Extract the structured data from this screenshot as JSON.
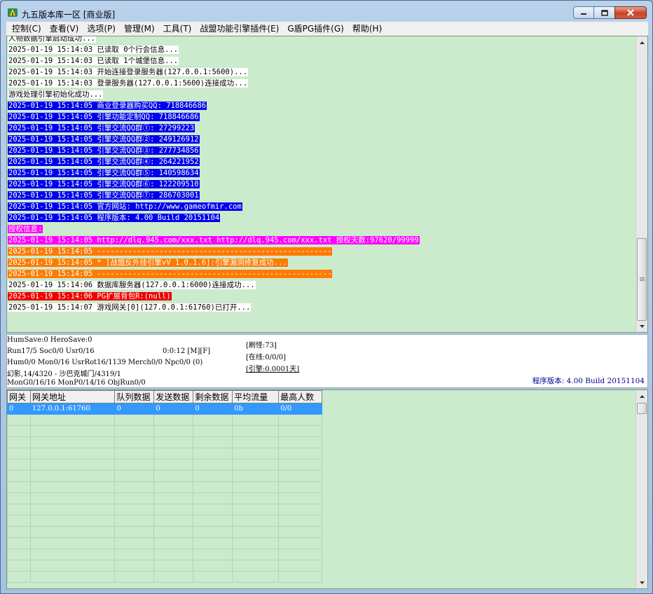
{
  "window": {
    "title": "九五版本库一区 [商业版]"
  },
  "menu": [
    "控制(C)",
    "查看(V)",
    "选项(P)",
    "管理(M)",
    "工具(T)",
    "战盟功能引擎插件(E)",
    "G盾PG插件(G)",
    "帮助(H)"
  ],
  "log": [
    {
      "text": "人物数据引擎启动成功...",
      "style": "white"
    },
    {
      "text": "2025-01-19 15:14:03 已读取 0个行会信息...",
      "style": "white"
    },
    {
      "text": "2025-01-19 15:14:03 已读取 1个城堡信息...",
      "style": "white"
    },
    {
      "text": "2025-01-19 15:14:03 开始连接登录服务器(127.0.0.1:5600)...",
      "style": "white"
    },
    {
      "text": "2025-01-19 15:14:03 登录服务器(127.0.0.1:5600)连接成功...",
      "style": "white"
    },
    {
      "text": "游戏处理引擎初始化成功...",
      "style": "white"
    },
    {
      "text": "2025-01-19 15:14:05 商业登录器购买QQ: 718846686",
      "style": "blue"
    },
    {
      "text": "2025-01-19 15:14:05 引擎功能定制QQ: 718846686",
      "style": "blue"
    },
    {
      "text": "2025-01-19 15:14:05 引擎交流QQ群①: 27299223",
      "style": "blue"
    },
    {
      "text": "2025-01-19 15:14:05 引擎交流QQ群②: 249126912",
      "style": "blue"
    },
    {
      "text": "2025-01-19 15:14:05 引擎交流QQ群③: 277734856",
      "style": "blue"
    },
    {
      "text": "2025-01-19 15:14:05 引擎交流QQ群④: 264221952",
      "style": "blue"
    },
    {
      "text": "2025-01-19 15:14:05 引擎交流QQ群⑤: 140598634",
      "style": "blue"
    },
    {
      "text": "2025-01-19 15:14:05 引擎交流QQ群⑥: 122209510",
      "style": "blue"
    },
    {
      "text": "2025-01-19 15:14:05 引擎交流QQ群⑦: 286703001",
      "style": "blue"
    },
    {
      "text": "2025-01-19 15:14:05 官方网站: http://www.gameofmir.com",
      "style": "blue"
    },
    {
      "text": "2025-01-19 15:14:05 程序版本: 4.00 Build 20151104",
      "style": "blue"
    },
    {
      "text": "授权信息:",
      "style": "magenta"
    },
    {
      "text": "2025-01-19 15:14:05 http://dlq.945.com/xxx.txt http://dlq.945.com/xxx.txt 授权天数:97620/99999",
      "style": "magenta"
    },
    {
      "text": "2025-01-19 15:14:05 -----------------------------------------------------",
      "style": "orange"
    },
    {
      "text": "2025-01-19 15:14:05 * [战盟反外挂引擎vV 1.0.1.6]:引擎漏洞修复成功...",
      "style": "orange"
    },
    {
      "text": "2025-01-19 15:14:05 -----------------------------------------------------",
      "style": "orange"
    },
    {
      "text": "2025-01-19 15:14:06 数据库服务器(127.0.0.1:6000)连接成功...",
      "style": "white"
    },
    {
      "text": "2025-01-19 15:14:06 PG扩展背包R:(null)",
      "style": "red"
    },
    {
      "text": "2025-01-19 15:14:07 游戏网关[0](127.0.0.1:61760)已打开...",
      "style": "white"
    }
  ],
  "status": {
    "line1": "HumSave:0 HeroSave:0",
    "line2": "Run17/5 Soc0/0 Usr0/16",
    "timer": "0:0:12 [M][F]",
    "line3": "Hum0/0 Mon0/16 UsrRot16/1139 Merch0/0 Npc0/0 (0)",
    "line4": "幻影,14/4320 - 沙巴克城门/4319/1",
    "line5": "MonG0/16/16 MonP0/14/16 ObjRun0/0",
    "refresh": "[刷怪:73]",
    "online": "[在线:0/0/0]",
    "engine": "[引擎:0.0001天]",
    "version": "程序版本: 4.00 Build 20151104"
  },
  "gateway_table": {
    "headers": [
      "网关",
      "网关地址",
      "队列数据",
      "发送数据",
      "剩余数据",
      "平均流量",
      "最高人数"
    ],
    "rows": [
      [
        "0",
        "127.0.0.1:61760",
        "0",
        "0",
        "0",
        "0b",
        "0/0"
      ]
    ]
  }
}
